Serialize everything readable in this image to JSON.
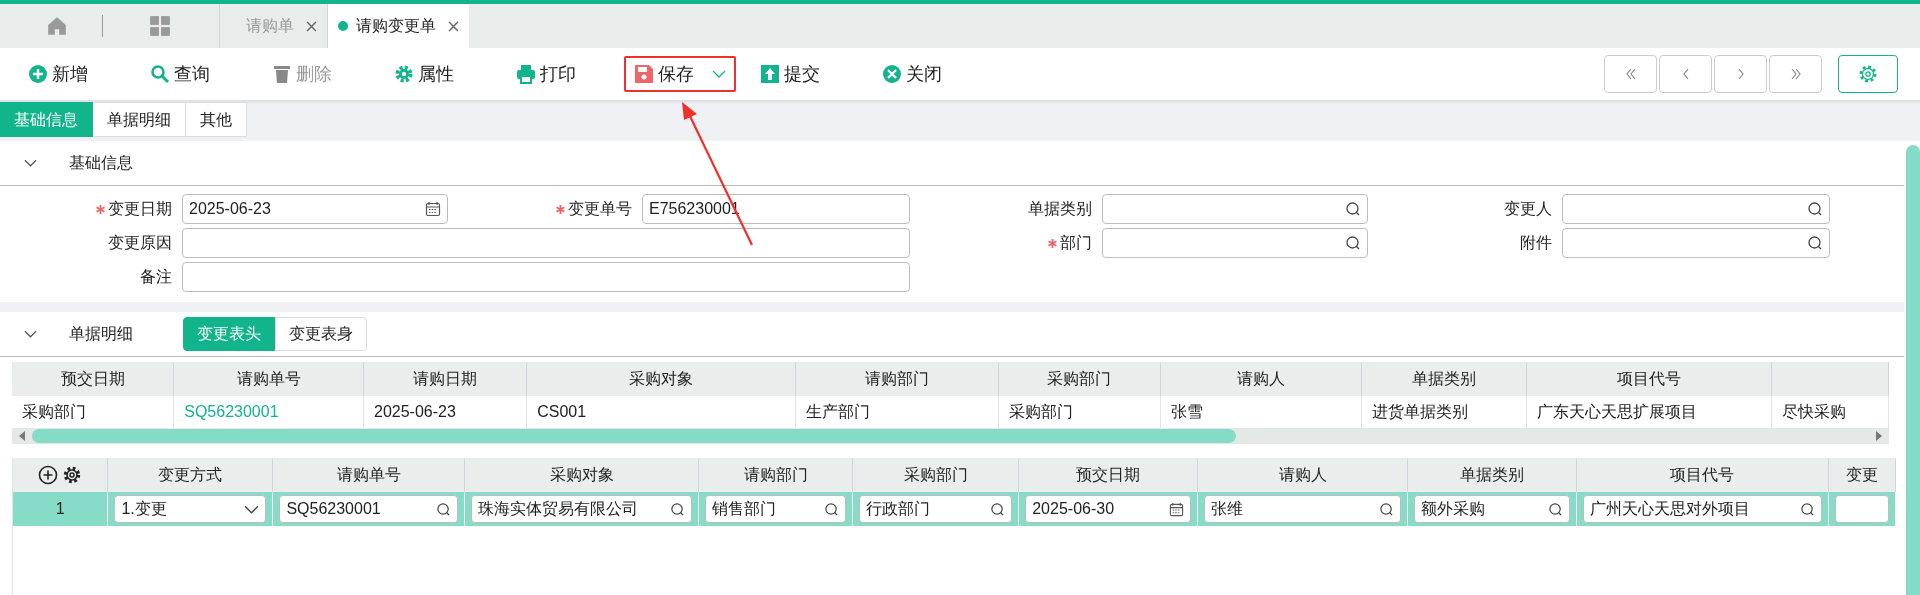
{
  "tabs": [
    {
      "label": "请购单",
      "selected": false
    },
    {
      "label": "请购变更单",
      "selected": true
    }
  ],
  "toolbar": [
    {
      "label": "新增",
      "kind": "add",
      "disabled": false,
      "highlighted": false,
      "dropdown": false
    },
    {
      "label": "查询",
      "kind": "search",
      "disabled": false,
      "highlighted": false,
      "dropdown": false
    },
    {
      "label": "删除",
      "kind": "delete",
      "disabled": true,
      "highlighted": false,
      "dropdown": false
    },
    {
      "label": "属性",
      "kind": "gear",
      "disabled": false,
      "highlighted": false,
      "dropdown": false
    },
    {
      "label": "打印",
      "kind": "print",
      "disabled": false,
      "highlighted": false,
      "dropdown": false
    },
    {
      "label": "保存",
      "kind": "save",
      "disabled": false,
      "highlighted": true,
      "dropdown": true
    },
    {
      "label": "提交",
      "kind": "submit",
      "disabled": false,
      "highlighted": false,
      "dropdown": false
    },
    {
      "label": "关闭",
      "kind": "close",
      "disabled": false,
      "highlighted": false,
      "dropdown": false
    }
  ],
  "section_tabs": [
    {
      "label": "基础信息",
      "selected": true
    },
    {
      "label": "单据明细",
      "selected": false
    },
    {
      "label": "其他",
      "selected": false
    }
  ],
  "basic_info": {
    "title": "基础信息",
    "expanded": true,
    "fields": [
      {
        "label": "变更日期",
        "required": true,
        "kind": "date",
        "value": "2025-06-23",
        "wide": false
      },
      {
        "label": "变更单号",
        "required": true,
        "kind": "text",
        "value": "E756230001",
        "wide": false
      },
      {
        "label": "单据类别",
        "required": false,
        "kind": "lookup",
        "wide": false
      },
      {
        "label": "变更人",
        "required": false,
        "kind": "lookup",
        "wide": false
      },
      {
        "label": "变更原因",
        "required": false,
        "kind": "text",
        "wide": true
      },
      {
        "label": "部门",
        "required": true,
        "kind": "lookup",
        "wide": false
      },
      {
        "label": "附件",
        "required": false,
        "kind": "lookup",
        "wide": false
      },
      {
        "label": "备注",
        "required": false,
        "kind": "text",
        "wide": true
      }
    ]
  },
  "detail": {
    "title": "单据明细",
    "expanded": true,
    "subtabs": [
      {
        "label": "变更表头",
        "selected": true
      },
      {
        "label": "变更表身",
        "selected": false
      }
    ],
    "header_table": {
      "columns": [
        {
          "label": "预交日期"
        },
        {
          "label": "请购单号"
        },
        {
          "label": "请购日期"
        },
        {
          "label": "采购对象"
        },
        {
          "label": "请购部门"
        },
        {
          "label": "采购部门"
        },
        {
          "label": "请购人"
        },
        {
          "label": "单据类别"
        },
        {
          "label": "项目代号"
        },
        {}
      ],
      "rows": [
        [
          {
            "kind": "text",
            "text": "采购部门"
          },
          {
            "kind": "link",
            "text": "SQ56230001"
          },
          {
            "kind": "text",
            "text": "2025-06-23"
          },
          {
            "kind": "text",
            "text": "CS001"
          },
          {
            "kind": "text",
            "text": "生产部门"
          },
          {
            "kind": "text",
            "text": "采购部门"
          },
          {
            "kind": "text",
            "text": "张雪"
          },
          {
            "kind": "text",
            "text": "进货单据类别"
          },
          {
            "kind": "text",
            "text": "广东天心天思扩展项目"
          },
          {
            "kind": "text",
            "text": "尽快采购"
          }
        ]
      ]
    },
    "body_table": {
      "columns": [
        "变更方式",
        "请购单号",
        "采购对象",
        "请购部门",
        "采购部门",
        "预交日期",
        "请购人",
        "单据类别",
        "项目代号",
        "变更"
      ],
      "rows": [
        {
          "index": "1",
          "selected": true,
          "cells": [
            {
              "kind": "select",
              "value": "1.变更"
            },
            {
              "kind": "lookup",
              "value": "SQ56230001"
            },
            {
              "kind": "lookup",
              "value": "珠海实体贸易有限公司"
            },
            {
              "kind": "lookup",
              "value": "销售部门"
            },
            {
              "kind": "lookup",
              "value": "行政部门"
            },
            {
              "kind": "date",
              "value": "2025-06-30"
            },
            {
              "kind": "lookup",
              "value": "张维"
            },
            {
              "kind": "lookup",
              "value": "额外采购"
            },
            {
              "kind": "lookup",
              "value": "广州天心天思对外项目"
            },
            {
              "kind": "text"
            }
          ]
        }
      ]
    }
  }
}
